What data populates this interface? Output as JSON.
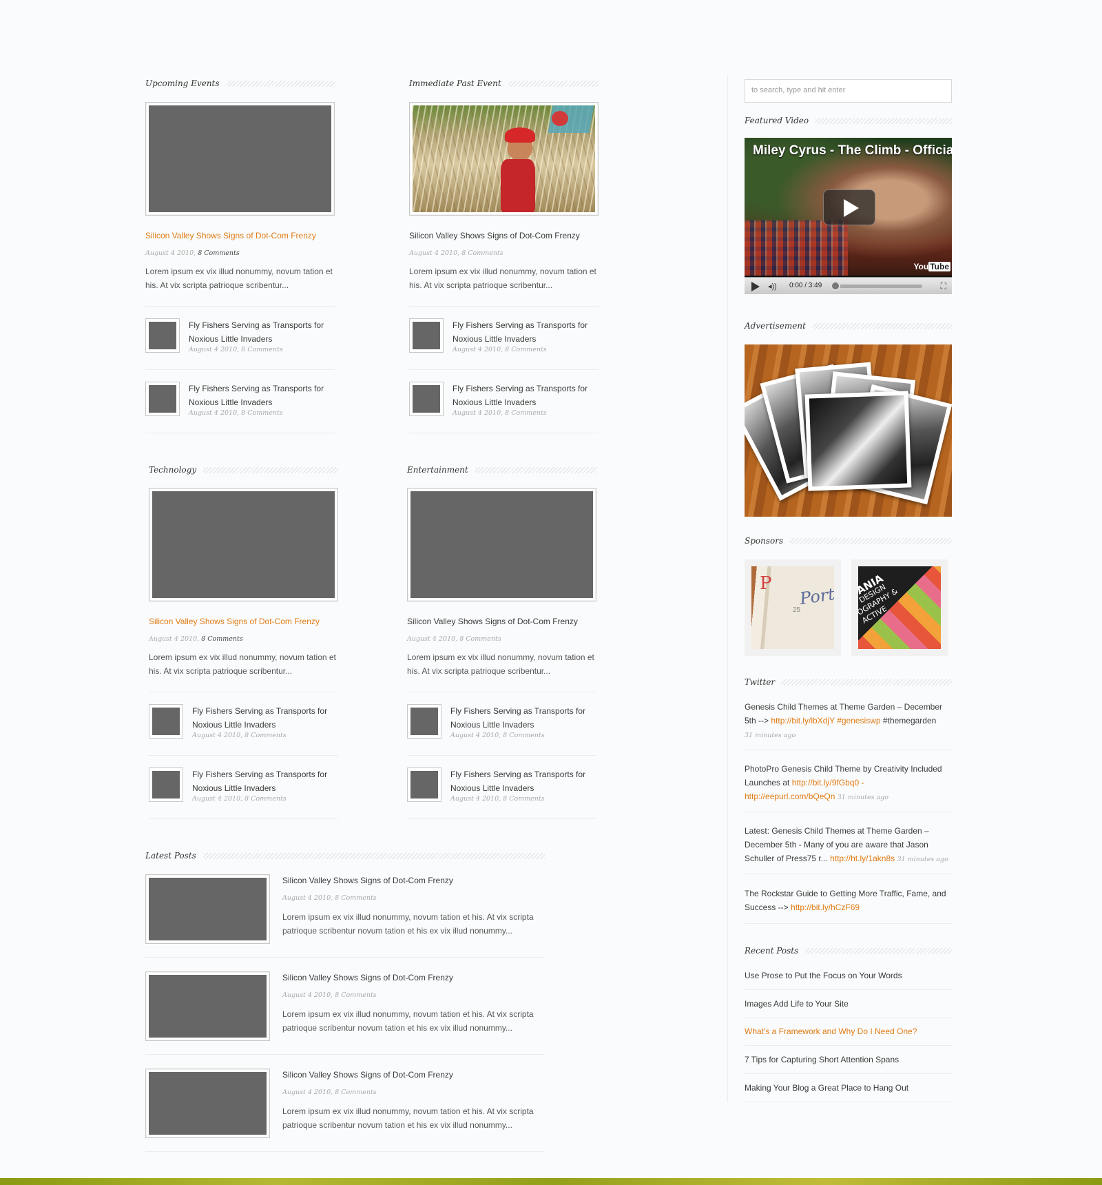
{
  "sections": {
    "upcoming": {
      "title": "Upcoming Events"
    },
    "past": {
      "title": "Immediate Past Event"
    },
    "technology": {
      "title": "Technology"
    },
    "entertainment": {
      "title": "Entertainment"
    },
    "latest": {
      "title": "Latest Posts"
    }
  },
  "feature": {
    "title": "Silicon Valley Shows Signs of Dot-Com Frenzy",
    "date": "August 4 2010,",
    "comments": "8 Comments",
    "excerpt": "Lorem ipsum ex vix illud nonummy, novum tation et his. At vix scripta patrioque scribentur..."
  },
  "small": {
    "title": "Fly Fishers Serving as Transports for Noxious Little Invaders",
    "meta": "August 4 2010, 8 Comments"
  },
  "latest_post": {
    "title": "Silicon Valley Shows Signs of Dot-Com Frenzy",
    "meta": "August 4 2010, 8 Comments",
    "excerpt": "Lorem ipsum ex vix illud nonummy, novum tation et his. At vix scripta patrioque scribentur novum tation et his ex vix illud nonummy..."
  },
  "sidebar": {
    "search_placeholder": "to search, type and hit enter",
    "featured_video": "Featured Video",
    "video_title": "Miley Cyrus - The Climb - Official ...",
    "video_time": "0:00 / 3:49",
    "advertisement": "Advertisement",
    "sponsors": "Sponsors",
    "twitter": "Twitter",
    "tweets": [
      {
        "text": "Genesis Child Themes at Theme Garden – December 5th -->",
        "link": "http://bit.ly/ibXdjY #genesiswp",
        "tail": "#themegarden",
        "ago": "31 minutes ago"
      },
      {
        "text": "PhotoPro Genesis Child Theme by Creativity Included Launches at",
        "link": "http://bit.ly/9fGbq0 - http://eepurl.com/bQeQn",
        "ago": "31 minutes ago"
      },
      {
        "text": "Latest: Genesis Child Themes at Theme Garden – December 5th - Many of you are aware that Jason Schuller of Press75 r...",
        "link": "http://ht.ly/1akn8s",
        "ago": "31 minutes ago"
      },
      {
        "text": "The Rockstar Guide to Getting More Traffic, Fame, and Success -->",
        "link": "http://bit.ly/hCzF69"
      }
    ],
    "recent_posts": "Recent Posts",
    "recent": [
      "Use Prose to Put the Focus on Your Words",
      "Images Add Life to Your Site",
      "What's a Framework and Why Do I Need One?",
      "7 Tips for Capturing Short Attention Spans",
      "Making Your Blog a Great Place to Hang Out"
    ],
    "sponsor_texts": [
      "Portfo",
      "25",
      "MANIA",
      "C DESIGN",
      "OGRAPHY &",
      "ACTIVE"
    ]
  },
  "colors": {
    "accent": "#e07b14",
    "placeholder": "#666666",
    "background": "#fafbfc"
  },
  "icons": [
    "play-icon",
    "volume-icon",
    "fullscreen-icon",
    "youtube-logo"
  ]
}
